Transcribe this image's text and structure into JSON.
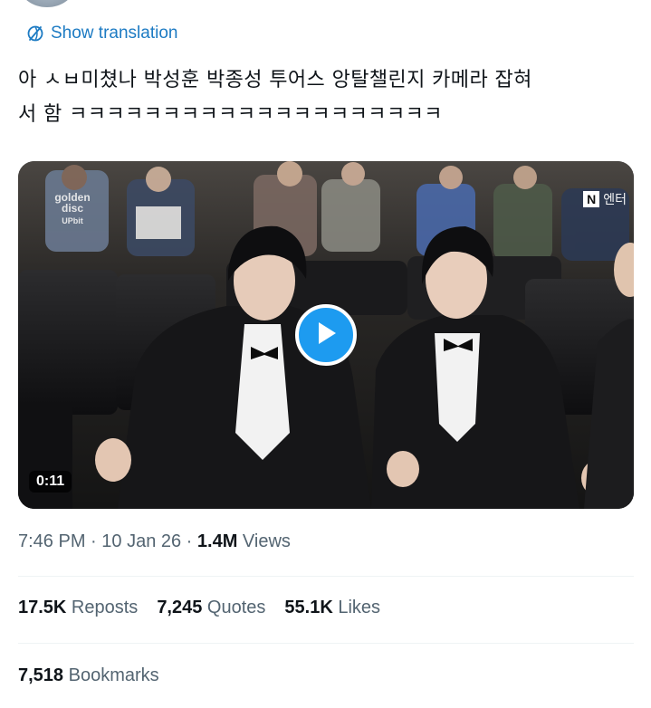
{
  "translation": {
    "label": "Show translation",
    "icon": "globe-translate-icon"
  },
  "tweet": {
    "text": "아 ㅅㅂ미쳤나 박성훈 박종성 투어스 앙탈챌린지 카메라 잡혀\n서 함 ㅋㅋㅋㅋㅋㅋㅋㅋㅋㅋㅋㅋㅋㅋㅋㅋㅋㅋㅋㅋ"
  },
  "video": {
    "duration": "0:11",
    "watermark_left_line1": "golden",
    "watermark_left_line2": "disc",
    "watermark_left_line3": "UPbit",
    "watermark_right_logo": "N",
    "watermark_right_text": "엔터"
  },
  "meta": {
    "time": "7:46 PM",
    "separator": " · ",
    "date": "10 Jan 26",
    "views_count": "1.4M",
    "views_label": " Views"
  },
  "stats": {
    "reposts_count": "17.5K",
    "reposts_label": " Reposts",
    "quotes_count": "7,245",
    "quotes_label": " Quotes",
    "likes_count": "55.1K",
    "likes_label": " Likes",
    "bookmarks_count": "7,518",
    "bookmarks_label": " Bookmarks"
  },
  "colors": {
    "link": "#1d7bc3",
    "play_button": "#1d9bf0",
    "secondary_text": "#536471",
    "primary_text": "#0f1419"
  }
}
